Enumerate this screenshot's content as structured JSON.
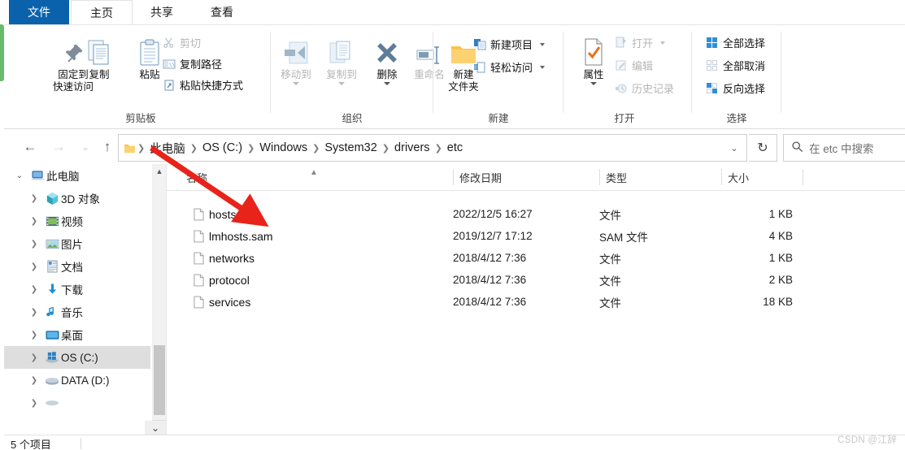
{
  "window": {
    "tabs": [
      {
        "id": "file",
        "label": "文件",
        "active": false,
        "accent": "#0b62ac"
      },
      {
        "id": "home",
        "label": "主页",
        "active": true
      },
      {
        "id": "share",
        "label": "共享",
        "active": false
      },
      {
        "id": "view",
        "label": "查看",
        "active": false
      }
    ]
  },
  "ribbon": {
    "groups": [
      {
        "id": "clipboard",
        "label": "剪贴板",
        "big": [
          {
            "id": "pin-to-quick-access",
            "label": "固定到\n快速访问",
            "icon": "pin-icon",
            "disabled": false
          },
          {
            "id": "copy",
            "label": "复制",
            "icon": "copy-icon",
            "disabled": false
          },
          {
            "id": "paste",
            "label": "粘贴",
            "icon": "paste-icon",
            "disabled": false
          }
        ],
        "small": [
          {
            "id": "cut",
            "label": "剪切",
            "icon": "scissors-icon",
            "disabled": true
          },
          {
            "id": "copy-path",
            "label": "复制路径",
            "icon": "copy-path-icon",
            "disabled": false
          },
          {
            "id": "paste-shortcut",
            "label": "粘贴快捷方式",
            "icon": "paste-shortcut-icon",
            "disabled": false
          }
        ]
      },
      {
        "id": "organize",
        "label": "组织",
        "big": [
          {
            "id": "move-to",
            "label": "移动到",
            "icon": "move-to-icon",
            "disabled": true,
            "caret": true
          },
          {
            "id": "copy-to",
            "label": "复制到",
            "icon": "copy-to-icon",
            "disabled": true,
            "caret": true
          },
          {
            "id": "delete",
            "label": "删除",
            "icon": "delete-x-icon",
            "disabled": false,
            "caret": true
          },
          {
            "id": "rename",
            "label": "重命名",
            "icon": "rename-icon",
            "disabled": true
          }
        ],
        "small": []
      },
      {
        "id": "new",
        "label": "新建",
        "big": [
          {
            "id": "new-folder",
            "label": "新建\n文件夹",
            "icon": "folder-icon",
            "disabled": false
          }
        ],
        "small": [
          {
            "id": "new-item",
            "label": "新建项目",
            "icon": "new-item-icon",
            "disabled": false,
            "caret": true
          },
          {
            "id": "easy-access",
            "label": "轻松访问",
            "icon": "easy-access-icon",
            "disabled": false,
            "caret": true
          }
        ]
      },
      {
        "id": "open",
        "label": "打开",
        "big": [
          {
            "id": "properties",
            "label": "属性",
            "icon": "properties-icon",
            "disabled": false,
            "caret": true
          }
        ],
        "small": [
          {
            "id": "open",
            "label": "打开",
            "icon": "open-icon",
            "disabled": true,
            "caret": true
          },
          {
            "id": "edit",
            "label": "编辑",
            "icon": "edit-icon",
            "disabled": true
          },
          {
            "id": "history",
            "label": "历史记录",
            "icon": "history-icon",
            "disabled": true
          }
        ]
      },
      {
        "id": "select",
        "label": "选择",
        "big": [],
        "small": [
          {
            "id": "select-all",
            "label": "全部选择",
            "icon": "select-all-icon",
            "disabled": false
          },
          {
            "id": "select-none",
            "label": "全部取消",
            "icon": "select-none-icon",
            "disabled": false
          },
          {
            "id": "invert-selection",
            "label": "反向选择",
            "icon": "invert-selection-icon",
            "disabled": false
          }
        ]
      }
    ]
  },
  "navbar": {
    "back_icon": "back-arrow-icon",
    "forward_icon": "forward-arrow-icon",
    "recent_icon": "chevron-down-icon",
    "up_icon": "up-arrow-icon",
    "breadcrumb": [
      "此电脑",
      "OS (C:)",
      "Windows",
      "System32",
      "drivers",
      "etc"
    ],
    "dropdown_icon": "chevron-down-icon",
    "refresh_icon": "refresh-icon",
    "search": {
      "icon": "search-icon",
      "placeholder": "在 etc 中搜索",
      "value": ""
    }
  },
  "navpane": {
    "items": [
      {
        "id": "this-pc",
        "label": "此电脑",
        "icon": "pc-icon",
        "indent": 0,
        "expanded": true,
        "selected": false
      },
      {
        "id": "3d-objects",
        "label": "3D 对象",
        "icon": "cube-icon",
        "indent": 1,
        "expanded": false,
        "selected": false
      },
      {
        "id": "videos",
        "label": "视频",
        "icon": "video-icon",
        "indent": 1,
        "expanded": false,
        "selected": false
      },
      {
        "id": "pictures",
        "label": "图片",
        "icon": "picture-icon",
        "indent": 1,
        "expanded": false,
        "selected": false
      },
      {
        "id": "documents",
        "label": "文档",
        "icon": "document-icon",
        "indent": 1,
        "expanded": false,
        "selected": false
      },
      {
        "id": "downloads",
        "label": "下载",
        "icon": "download-icon",
        "indent": 1,
        "expanded": false,
        "selected": false
      },
      {
        "id": "music",
        "label": "音乐",
        "icon": "music-icon",
        "indent": 1,
        "expanded": false,
        "selected": false
      },
      {
        "id": "desktop",
        "label": "桌面",
        "icon": "desktop-icon",
        "indent": 1,
        "expanded": false,
        "selected": false
      },
      {
        "id": "os-c",
        "label": "OS (C:)",
        "icon": "windows-drive-icon",
        "indent": 1,
        "expanded": false,
        "selected": true
      },
      {
        "id": "data-d",
        "label": "DATA (D:)",
        "icon": "drive-icon",
        "indent": 1,
        "expanded": false,
        "selected": false
      }
    ],
    "scroll_up_icon": "chevron-up-icon",
    "scroll_down_icon": "chevron-down-icon"
  },
  "filelist": {
    "columns": [
      {
        "id": "name",
        "label": "名称",
        "sorted": true,
        "sort_icon": "chevron-up-icon"
      },
      {
        "id": "date",
        "label": "修改日期"
      },
      {
        "id": "type",
        "label": "类型"
      },
      {
        "id": "size",
        "label": "大小"
      }
    ],
    "rows": [
      {
        "name": "hosts",
        "date": "2022/12/5 16:27",
        "type": "文件",
        "size": "1 KB",
        "icon": "file-icon"
      },
      {
        "name": "lmhosts.sam",
        "date": "2019/12/7 17:12",
        "type": "SAM 文件",
        "size": "4 KB",
        "icon": "file-icon"
      },
      {
        "name": "networks",
        "date": "2018/4/12 7:36",
        "type": "文件",
        "size": "1 KB",
        "icon": "file-icon"
      },
      {
        "name": "protocol",
        "date": "2018/4/12 7:36",
        "type": "文件",
        "size": "2 KB",
        "icon": "file-icon"
      },
      {
        "name": "services",
        "date": "2018/4/12 7:36",
        "type": "文件",
        "size": "18 KB",
        "icon": "file-icon"
      }
    ]
  },
  "statusbar": {
    "count": "5 个项目"
  },
  "collapse_ribbon_icon": "chevron-down-icon",
  "watermark": "CSDN @江辞",
  "colors": {
    "accent": "#0b62ac",
    "selection": "#dedede",
    "annotation": "#e8231a",
    "folder": "#fbc34b"
  }
}
